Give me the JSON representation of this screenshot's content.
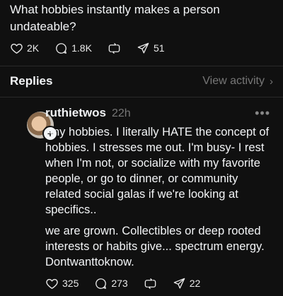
{
  "post": {
    "text": "What hobbies instantly makes a person undateable?",
    "likes": "2K",
    "comments": "1.8K",
    "shares": "51",
    "icons": [
      "heart-icon",
      "comment-icon",
      "repost-icon",
      "share-icon"
    ]
  },
  "replies_bar": {
    "title": "Replies",
    "view_activity": "View activity",
    "chevron": "›"
  },
  "reply": {
    "username": "ruthietwos",
    "time": "22h",
    "more": "•••",
    "paragraph1": "Any hobbies. I literally HATE the concept of hobbies. I stresses me out. I'm busy- I rest when I'm not, or socialize with my favorite people, or go to dinner, or community related social galas if we're looking at specifics..",
    "paragraph2": "we are grown. Collectibles or deep rooted interests or habits give... spectrum energy. Dontwanttoknow.",
    "likes": "325",
    "comments": "273",
    "shares": "22",
    "follow_badge": "+"
  },
  "colors": {
    "background": "#101010",
    "text": "#f3f5f7",
    "muted": "#777777",
    "divider": "#2a2a2a"
  }
}
